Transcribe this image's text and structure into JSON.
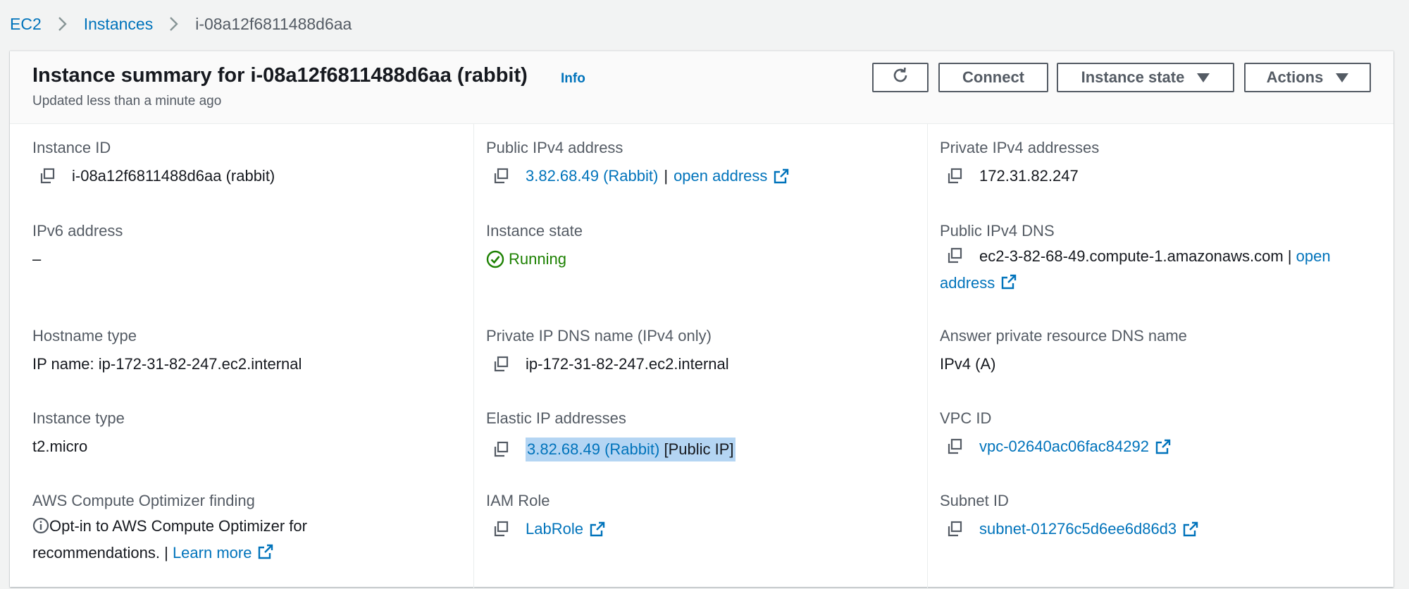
{
  "breadcrumb": {
    "items": [
      "EC2",
      "Instances"
    ],
    "current": "i-08a12f6811488d6aa"
  },
  "header": {
    "title": "Instance summary for i-08a12f6811488d6aa (rabbit)",
    "info": "Info",
    "subtitle": "Updated less than a minute ago",
    "buttons": {
      "connect": "Connect",
      "instance_state": "Instance state",
      "actions": "Actions"
    }
  },
  "details": {
    "instance_id": {
      "label": "Instance ID",
      "value": "i-08a12f6811488d6aa (rabbit)"
    },
    "ipv6": {
      "label": "IPv6 address",
      "value": "–"
    },
    "hostname_type": {
      "label": "Hostname type",
      "value": "IP name: ip-172-31-82-247.ec2.internal"
    },
    "instance_type": {
      "label": "Instance type",
      "value": "t2.micro"
    },
    "optimizer": {
      "label": "AWS Compute Optimizer finding",
      "text": "Opt-in to AWS Compute Optimizer for recommendations. |",
      "link": "Learn more"
    },
    "public_ipv4": {
      "label": "Public IPv4 address",
      "value": "3.82.68.49 (Rabbit)",
      "sep": "|",
      "link": "open address"
    },
    "instance_state": {
      "label": "Instance state",
      "value": "Running"
    },
    "private_dns": {
      "label": "Private IP DNS name (IPv4 only)",
      "value": "ip-172-31-82-247.ec2.internal"
    },
    "elastic_ip": {
      "label": "Elastic IP addresses",
      "value": "3.82.68.49 (Rabbit)",
      "suffix": "[Public IP]"
    },
    "iam_role": {
      "label": "IAM Role",
      "value": "LabRole"
    },
    "private_ipv4": {
      "label": "Private IPv4 addresses",
      "value": "172.31.82.247"
    },
    "public_dns": {
      "label": "Public IPv4 DNS",
      "value": "ec2-3-82-68-49.compute-1.amazonaws.com",
      "sep": "|",
      "link": "open address"
    },
    "answer_dns": {
      "label": "Answer private resource DNS name",
      "value": "IPv4 (A)"
    },
    "vpc_id": {
      "label": "VPC ID",
      "value": "vpc-02640ac06fac84292"
    },
    "subnet_id": {
      "label": "Subnet ID",
      "value": "subnet-01276c5d6ee6d86d3"
    }
  },
  "colors": {
    "link": "#0073bb",
    "success": "#1d8102",
    "highlight": "#b4d5f3"
  }
}
